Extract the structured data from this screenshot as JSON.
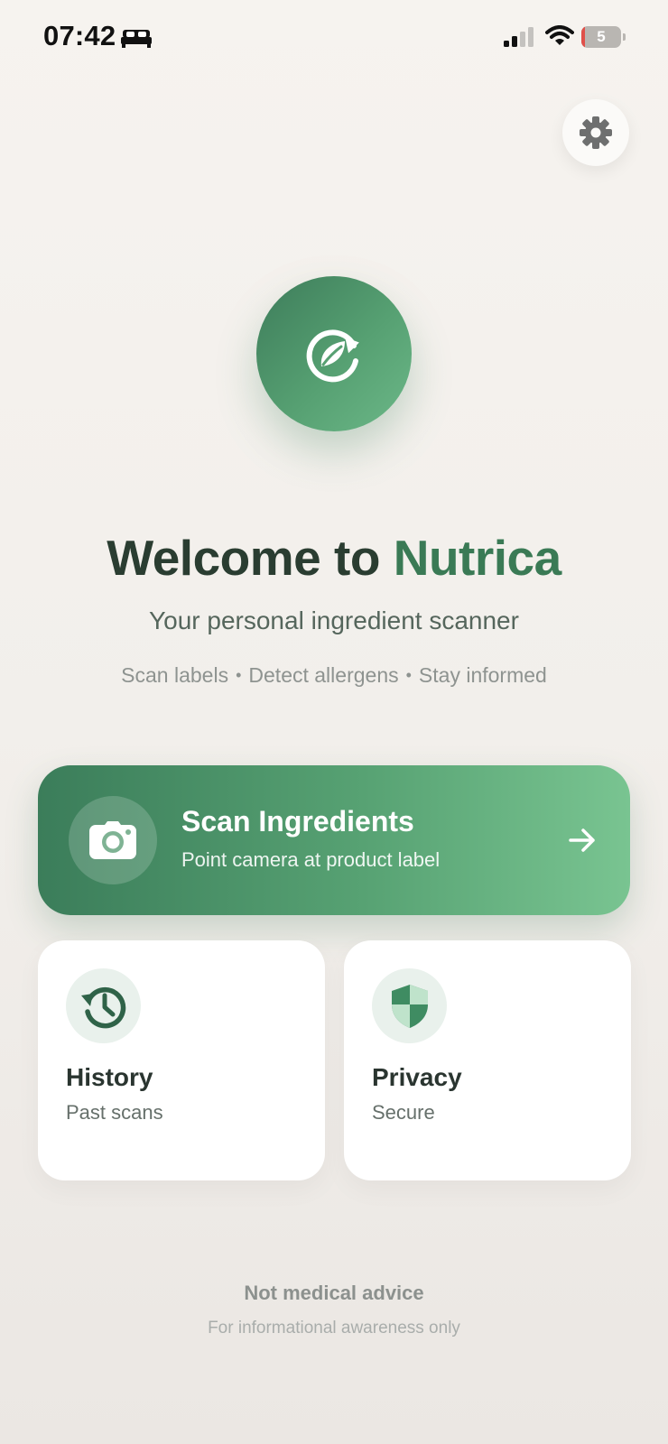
{
  "status_bar": {
    "time": "07:42",
    "battery_percent": "5",
    "battery_level": 0.05,
    "icons": [
      "bed-icon",
      "cellular-signal-icon",
      "wifi-icon",
      "battery-icon"
    ]
  },
  "header": {
    "settings_icon": "gear-icon"
  },
  "hero": {
    "logo_icon": "leaf-refresh-icon",
    "title_prefix": "Welcome to ",
    "title_brand": "Nutrica",
    "subtitle": "Your personal ingredient scanner",
    "features": [
      "Scan labels",
      "Detect allergens",
      "Stay informed"
    ]
  },
  "scan_card": {
    "title": "Scan Ingredients",
    "subtitle": "Point camera at product label",
    "icon": "camera-icon",
    "action_icon": "arrow-right-icon"
  },
  "tiles": [
    {
      "title": "History",
      "subtitle": "Past scans",
      "icon": "history-icon"
    },
    {
      "title": "Privacy",
      "subtitle": "Secure",
      "icon": "shield-icon"
    }
  ],
  "footer": {
    "disclaimer": "Not medical advice",
    "note": "For informational awareness only"
  },
  "colors": {
    "brand_green": "#3a7a55",
    "accent_light_green": "#79c491",
    "background": "#f3f0ec"
  }
}
